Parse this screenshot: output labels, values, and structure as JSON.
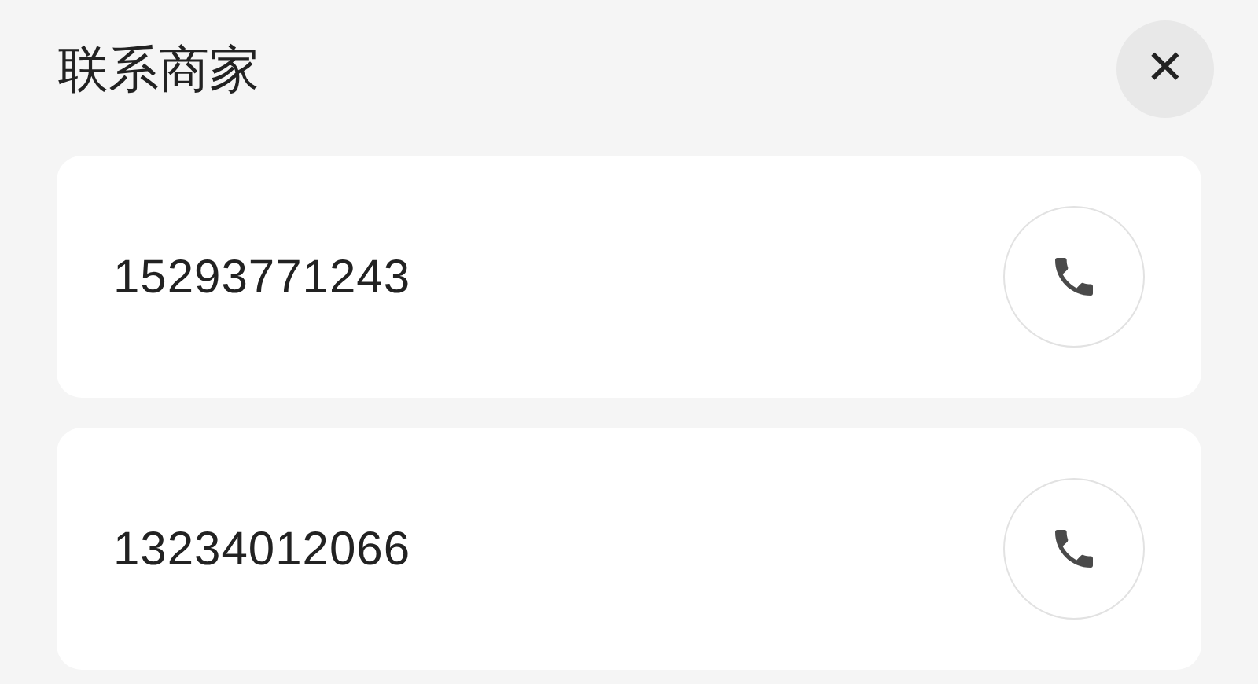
{
  "dialog": {
    "title": "联系商家",
    "close_label": "✕"
  },
  "contacts": [
    {
      "phone": "15293771243"
    },
    {
      "phone": "13234012066"
    }
  ]
}
